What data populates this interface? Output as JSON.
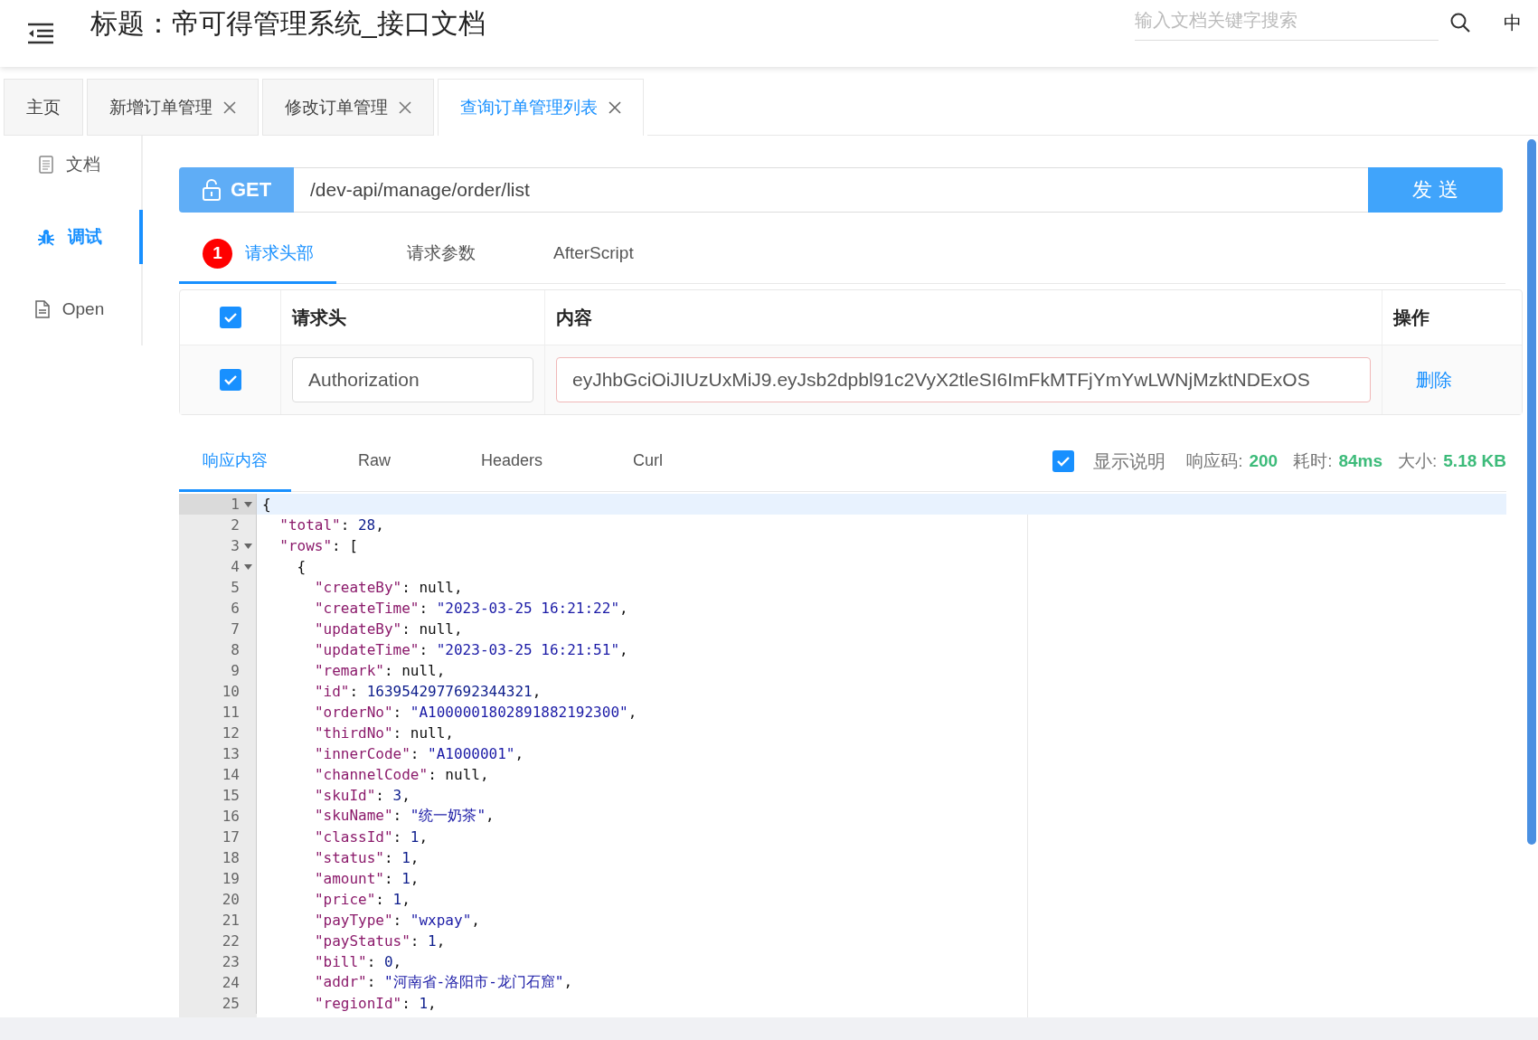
{
  "header": {
    "title": "标题：帝可得管理系统_接口文档",
    "search": {
      "placeholder": "输入文档关键字搜索"
    },
    "language": "中"
  },
  "tabs": [
    {
      "label": "主页",
      "closable": false,
      "selected": false
    },
    {
      "label": "新增订单管理",
      "closable": true,
      "selected": false
    },
    {
      "label": "修改订单管理",
      "closable": true,
      "selected": false
    },
    {
      "label": "查询订单管理列表",
      "closable": true,
      "selected": true
    }
  ],
  "sidebar": {
    "items": [
      {
        "label": "文档",
        "kind": "doc",
        "selected": false
      },
      {
        "label": "调试",
        "kind": "debug",
        "selected": true
      },
      {
        "label": "Open",
        "kind": "file",
        "selected": false
      }
    ]
  },
  "request": {
    "method": "GET",
    "url": "/dev-api/manage/order/list",
    "send_label": "发 送"
  },
  "request_tabs": [
    {
      "label": "请求头部",
      "badge": "1",
      "selected": true
    },
    {
      "label": "请求参数",
      "selected": false
    },
    {
      "label": "AfterScript",
      "selected": false
    }
  ],
  "headers_table": {
    "all_checked": true,
    "columns": [
      "请求头",
      "内容",
      "操作"
    ],
    "rows": [
      {
        "checked": true,
        "name": "Authorization",
        "value": "eyJhbGciOiJIUzUxMiJ9.eyJsb2dpbl91c2VyX2tleSI6ImFkMTFjYmYwLWNjMzktNDExOS",
        "action": "删除"
      }
    ]
  },
  "response_tabs": [
    {
      "label": "响应内容",
      "selected": true
    },
    {
      "label": "Raw",
      "selected": false
    },
    {
      "label": "Headers",
      "selected": false
    },
    {
      "label": "Curl",
      "selected": false
    }
  ],
  "response_info": {
    "show_description": {
      "label": "显示说明",
      "checked": true
    },
    "code_label": "响应码:",
    "code": "200",
    "time_label": "耗时:",
    "time": "84ms",
    "size_label": "大小:",
    "size": "5.18 KB"
  },
  "editor_lines": [
    {
      "num": "1",
      "foldable": true,
      "current": true,
      "tokens": [
        {
          "kind": "punct",
          "text": "{"
        }
      ],
      "children": [
        {
          "num": "2",
          "foldable": false,
          "current": false,
          "tokens": [
            {
              "kind": "key",
              "text": "\"total\""
            },
            {
              "kind": "punct",
              "text": ":"
            },
            {
              "kind": "number",
              "text": "28"
            },
            {
              "kind": "punct",
              "text": ","
            }
          ]
        },
        {
          "num": "3",
          "foldable": true,
          "current": false,
          "tokens": [
            {
              "kind": "key",
              "text": "\"rows\""
            },
            {
              "kind": "punct",
              "text": ":"
            },
            {
              "kind": "punct",
              "text": "["
            }
          ],
          "children": [
            {
              "num": "4",
              "foldable": true,
              "current": false,
              "tokens": [
                {
                  "kind": "punct",
                  "text": "{"
                }
              ],
              "children": [
                {
                  "num": "5",
                  "foldable": false,
                  "current": false,
                  "tokens": [
                    {
                      "kind": "key",
                      "text": "\"createBy\""
                    },
                    {
                      "kind": "punct",
                      "text": ":"
                    },
                    {
                      "kind": "null",
                      "text": "null"
                    },
                    {
                      "kind": "punct",
                      "text": ","
                    }
                  ]
                },
                {
                  "num": "6",
                  "foldable": false,
                  "current": false,
                  "tokens": [
                    {
                      "kind": "key",
                      "text": "\"createTime\""
                    },
                    {
                      "kind": "punct",
                      "text": ":"
                    },
                    {
                      "kind": "string",
                      "text": "\"2023-03-25 16:21:22\""
                    },
                    {
                      "kind": "punct",
                      "text": ","
                    }
                  ]
                },
                {
                  "num": "7",
                  "foldable": false,
                  "current": false,
                  "tokens": [
                    {
                      "kind": "key",
                      "text": "\"updateBy\""
                    },
                    {
                      "kind": "punct",
                      "text": ":"
                    },
                    {
                      "kind": "null",
                      "text": "null"
                    },
                    {
                      "kind": "punct",
                      "text": ","
                    }
                  ]
                },
                {
                  "num": "8",
                  "foldable": false,
                  "current": false,
                  "tokens": [
                    {
                      "kind": "key",
                      "text": "\"updateTime\""
                    },
                    {
                      "kind": "punct",
                      "text": ":"
                    },
                    {
                      "kind": "string",
                      "text": "\"2023-03-25 16:21:51\""
                    },
                    {
                      "kind": "punct",
                      "text": ","
                    }
                  ]
                },
                {
                  "num": "9",
                  "foldable": false,
                  "current": false,
                  "tokens": [
                    {
                      "kind": "key",
                      "text": "\"remark\""
                    },
                    {
                      "kind": "punct",
                      "text": ":"
                    },
                    {
                      "kind": "null",
                      "text": "null"
                    },
                    {
                      "kind": "punct",
                      "text": ","
                    }
                  ]
                },
                {
                  "num": "10",
                  "foldable": false,
                  "current": false,
                  "tokens": [
                    {
                      "kind": "key",
                      "text": "\"id\""
                    },
                    {
                      "kind": "punct",
                      "text": ":"
                    },
                    {
                      "kind": "number",
                      "text": "1639542977692344321"
                    },
                    {
                      "kind": "punct",
                      "text": ","
                    }
                  ]
                },
                {
                  "num": "11",
                  "foldable": false,
                  "current": false,
                  "tokens": [
                    {
                      "kind": "key",
                      "text": "\"orderNo\""
                    },
                    {
                      "kind": "punct",
                      "text": ":"
                    },
                    {
                      "kind": "string",
                      "text": "\"A1000001802891882192300\""
                    },
                    {
                      "kind": "punct",
                      "text": ","
                    }
                  ]
                },
                {
                  "num": "12",
                  "foldable": false,
                  "current": false,
                  "tokens": [
                    {
                      "kind": "key",
                      "text": "\"thirdNo\""
                    },
                    {
                      "kind": "punct",
                      "text": ":"
                    },
                    {
                      "kind": "null",
                      "text": "null"
                    },
                    {
                      "kind": "punct",
                      "text": ","
                    }
                  ]
                },
                {
                  "num": "13",
                  "foldable": false,
                  "current": false,
                  "tokens": [
                    {
                      "kind": "key",
                      "text": "\"innerCode\""
                    },
                    {
                      "kind": "punct",
                      "text": ":"
                    },
                    {
                      "kind": "string",
                      "text": "\"A1000001\""
                    },
                    {
                      "kind": "punct",
                      "text": ","
                    }
                  ]
                },
                {
                  "num": "14",
                  "foldable": false,
                  "current": false,
                  "tokens": [
                    {
                      "kind": "key",
                      "text": "\"channelCode\""
                    },
                    {
                      "kind": "punct",
                      "text": ":"
                    },
                    {
                      "kind": "null",
                      "text": "null"
                    },
                    {
                      "kind": "punct",
                      "text": ","
                    }
                  ]
                },
                {
                  "num": "15",
                  "foldable": false,
                  "current": false,
                  "tokens": [
                    {
                      "kind": "key",
                      "text": "\"skuId\""
                    },
                    {
                      "kind": "punct",
                      "text": ":"
                    },
                    {
                      "kind": "number",
                      "text": "3"
                    },
                    {
                      "kind": "punct",
                      "text": ","
                    }
                  ]
                },
                {
                  "num": "16",
                  "foldable": false,
                  "current": false,
                  "tokens": [
                    {
                      "kind": "key",
                      "text": "\"skuName\""
                    },
                    {
                      "kind": "punct",
                      "text": ":"
                    },
                    {
                      "kind": "string",
                      "text": "\"统一奶茶\""
                    },
                    {
                      "kind": "punct",
                      "text": ","
                    }
                  ]
                },
                {
                  "num": "17",
                  "foldable": false,
                  "current": false,
                  "tokens": [
                    {
                      "kind": "key",
                      "text": "\"classId\""
                    },
                    {
                      "kind": "punct",
                      "text": ":"
                    },
                    {
                      "kind": "number",
                      "text": "1"
                    },
                    {
                      "kind": "punct",
                      "text": ","
                    }
                  ]
                },
                {
                  "num": "18",
                  "foldable": false,
                  "current": false,
                  "tokens": [
                    {
                      "kind": "key",
                      "text": "\"status\""
                    },
                    {
                      "kind": "punct",
                      "text": ":"
                    },
                    {
                      "kind": "number",
                      "text": "1"
                    },
                    {
                      "kind": "punct",
                      "text": ","
                    }
                  ]
                },
                {
                  "num": "19",
                  "foldable": false,
                  "current": false,
                  "tokens": [
                    {
                      "kind": "key",
                      "text": "\"amount\""
                    },
                    {
                      "kind": "punct",
                      "text": ":"
                    },
                    {
                      "kind": "number",
                      "text": "1"
                    },
                    {
                      "kind": "punct",
                      "text": ","
                    }
                  ]
                },
                {
                  "num": "20",
                  "foldable": false,
                  "current": false,
                  "tokens": [
                    {
                      "kind": "key",
                      "text": "\"price\""
                    },
                    {
                      "kind": "punct",
                      "text": ":"
                    },
                    {
                      "kind": "number",
                      "text": "1"
                    },
                    {
                      "kind": "punct",
                      "text": ","
                    }
                  ]
                },
                {
                  "num": "21",
                  "foldable": false,
                  "current": false,
                  "tokens": [
                    {
                      "kind": "key",
                      "text": "\"payType\""
                    },
                    {
                      "kind": "punct",
                      "text": ":"
                    },
                    {
                      "kind": "string",
                      "text": "\"wxpay\""
                    },
                    {
                      "kind": "punct",
                      "text": ","
                    }
                  ]
                },
                {
                  "num": "22",
                  "foldable": false,
                  "current": false,
                  "tokens": [
                    {
                      "kind": "key",
                      "text": "\"payStatus\""
                    },
                    {
                      "kind": "punct",
                      "text": ":"
                    },
                    {
                      "kind": "number",
                      "text": "1"
                    },
                    {
                      "kind": "punct",
                      "text": ","
                    }
                  ]
                },
                {
                  "num": "23",
                  "foldable": false,
                  "current": false,
                  "tokens": [
                    {
                      "kind": "key",
                      "text": "\"bill\""
                    },
                    {
                      "kind": "punct",
                      "text": ":"
                    },
                    {
                      "kind": "number",
                      "text": "0"
                    },
                    {
                      "kind": "punct",
                      "text": ","
                    }
                  ]
                },
                {
                  "num": "24",
                  "foldable": false,
                  "current": false,
                  "tokens": [
                    {
                      "kind": "key",
                      "text": "\"addr\""
                    },
                    {
                      "kind": "punct",
                      "text": ":"
                    },
                    {
                      "kind": "string",
                      "text": "\"河南省-洛阳市-龙门石窟\""
                    },
                    {
                      "kind": "punct",
                      "text": ","
                    }
                  ]
                },
                {
                  "num": "25",
                  "foldable": false,
                  "current": false,
                  "tokens": [
                    {
                      "kind": "key",
                      "text": "\"regionId\""
                    },
                    {
                      "kind": "punct",
                      "text": ":"
                    },
                    {
                      "kind": "number",
                      "text": "1"
                    },
                    {
                      "kind": "punct",
                      "text": ","
                    }
                  ]
                }
              ]
            }
          ]
        }
      ]
    }
  ]
}
